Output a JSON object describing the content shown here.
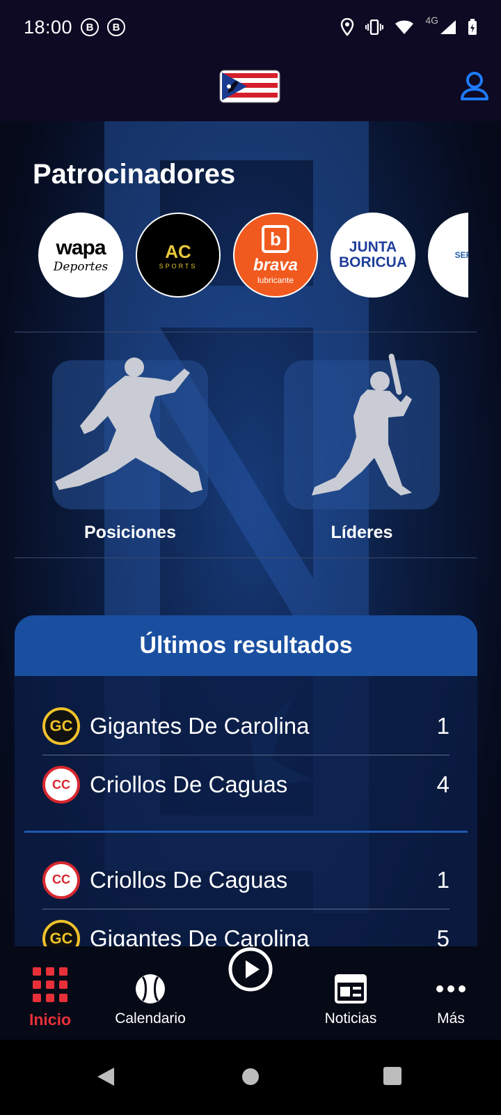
{
  "status_bar": {
    "time": "18:00",
    "notification_badges": [
      "B",
      "B"
    ],
    "network_label": "4G"
  },
  "header": {
    "logo_icon": "puerto-rico-flag-logo",
    "profile_icon": "user-icon"
  },
  "sponsors": {
    "title": "Patrocinadores",
    "items": [
      {
        "line1": "wapa",
        "line2": "Deportes"
      },
      {
        "line1": "AC",
        "line2": "SPORTS"
      },
      {
        "line1": "brava",
        "line2": "lubricante"
      },
      {
        "line1": "JUNTA",
        "line2": "BORICUA"
      },
      {
        "line1": "SERIED",
        "line2": ""
      }
    ]
  },
  "tiles": [
    {
      "label": "Posiciones",
      "icon": "pitcher-icon"
    },
    {
      "label": "Líderes",
      "icon": "batter-icon"
    }
  ],
  "results": {
    "title": "Últimos resultados",
    "games": [
      {
        "teams": [
          {
            "name": "Gigantes De Carolina",
            "score": "1",
            "logo": "GC"
          },
          {
            "name": "Criollos De Caguas",
            "score": "4",
            "logo": "CC"
          }
        ]
      },
      {
        "teams": [
          {
            "name": "Criollos De Caguas",
            "score": "1",
            "logo": "CC"
          },
          {
            "name": "Gigantes De Carolina",
            "score": "5",
            "logo": "GC"
          }
        ]
      }
    ]
  },
  "bottom_nav": {
    "items": [
      {
        "label": "Inicio",
        "icon": "grid-icon",
        "active": true
      },
      {
        "label": "Calendario",
        "icon": "baseball-icon"
      },
      {
        "label": "",
        "icon": "play-icon"
      },
      {
        "label": "Noticias",
        "icon": "news-icon"
      },
      {
        "label": "Más",
        "icon": "more-icon"
      }
    ]
  },
  "colors": {
    "accent_blue": "#1a4fa0",
    "active_red": "#e8303a",
    "profile_blue": "#1e7bff"
  }
}
